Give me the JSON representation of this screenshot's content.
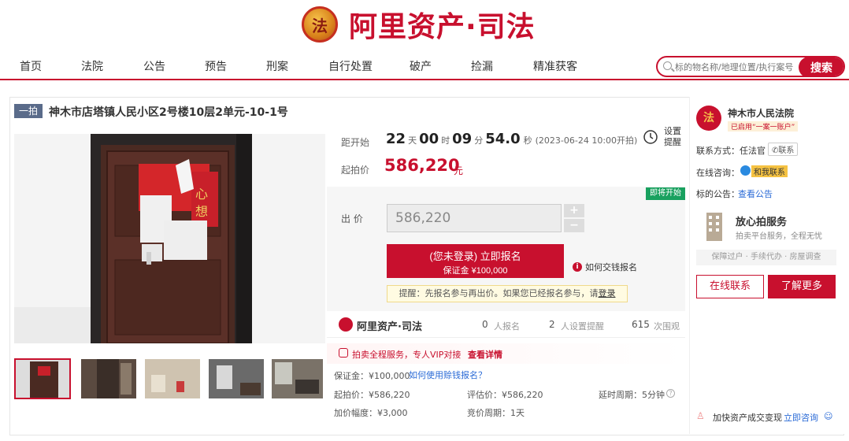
{
  "header": {
    "logo_emblem": "法",
    "logo_text": "阿里资产·司法"
  },
  "nav": [
    "首页",
    "法院",
    "公告",
    "预告",
    "刑案",
    "自行处置",
    "破产",
    "捡漏",
    "精准获客"
  ],
  "search": {
    "placeholder": "标的物名称/地理位置/执行案号",
    "button": "搜索"
  },
  "item": {
    "tag": "一拍",
    "title": "神木市店塔镇人民小区2号楼10层2单元-10-1号"
  },
  "countdown": {
    "label": "距开始",
    "days": "22",
    "days_unit": "天",
    "hours": "00",
    "hours_unit": "时",
    "minutes": "09",
    "minutes_unit": "分",
    "seconds": "54.0",
    "seconds_unit": "秒",
    "start_note": "(2023-06-24 10:00开拍)"
  },
  "reminder_setting": {
    "line1": "设置",
    "line2": "提醒"
  },
  "start_price": {
    "label": "起拍价",
    "value": "586,220",
    "unit": "元"
  },
  "bid": {
    "label": "出 价",
    "value": "586,220",
    "plus": "+",
    "minus": "−"
  },
  "status_badge": "即将开始",
  "register": {
    "line1": "(您未登录) 立即报名",
    "line2": "保证金 ¥100,000"
  },
  "how_to_pay": "如何交钱报名",
  "remind_text": "提醒：先报名参与再出价。如果您已经报名参与，请",
  "remind_link": "登录",
  "stats": {
    "brand": "阿里资产·司法",
    "signups": "0",
    "signups_label": "人报名",
    "reminders": "2",
    "reminders_label": "人设置提醒",
    "views": "615",
    "views_label": "次围观"
  },
  "vip": {
    "text": "拍卖全程服务，专人VIP对接",
    "link": "查看详情"
  },
  "details": {
    "deposit": "保证金：¥100,000",
    "deposit_link": "如何使用赊钱报名？",
    "start_price": "起拍价：¥586,220",
    "eval_price": "评估价：¥586,220",
    "delay": "延时周期：5分钟",
    "increment": "加价幅度：¥3,000",
    "cycle": "竞价周期：1天"
  },
  "court": {
    "name": "神木市人民法院",
    "badge": "已启用“一案一账户”",
    "contact_label": "联系方式：",
    "contact_value": "任法官",
    "contact_btn": "联系",
    "consult_label": "在线咨询：",
    "consult_btn": "和我联系",
    "notice_label": "标的公告：",
    "notice_link": "查看公告"
  },
  "service": {
    "title": "放心拍服务",
    "subtitle": "拍卖平台服务，全程无忧",
    "tags": "保障过户 · 手续代办 · 房屋调查"
  },
  "court_buttons": {
    "online": "在线联系",
    "more": "了解更多"
  },
  "footer_promo": {
    "text": "加快资产成交变现",
    "link": "立即咨询"
  },
  "colors": {
    "brand_red": "#c8102e",
    "green_badge": "#19a15f",
    "tag_blue": "#5a6b8a"
  }
}
